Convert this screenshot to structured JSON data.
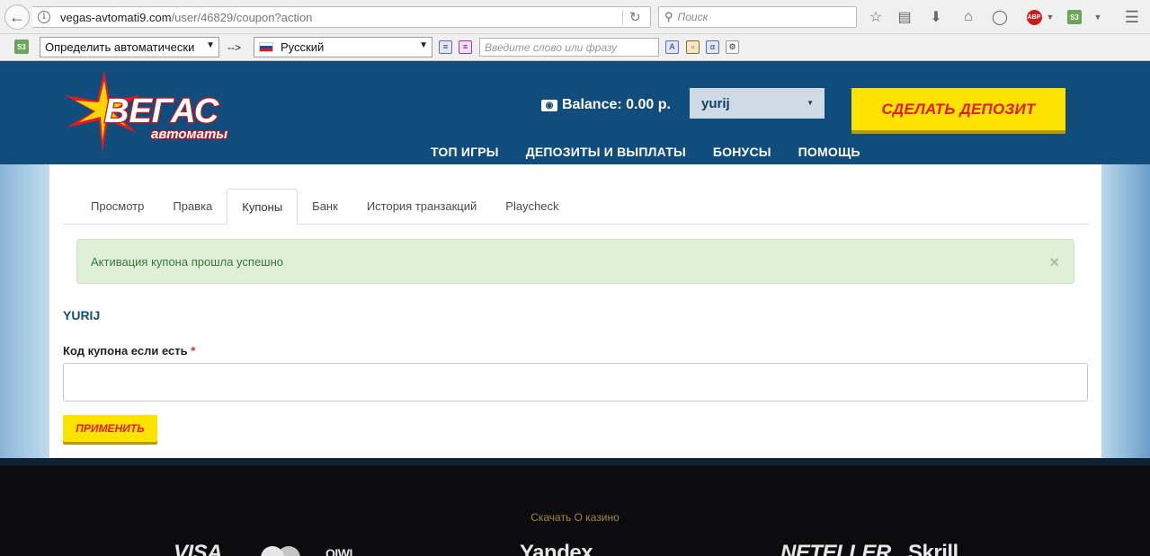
{
  "browser": {
    "url_host": "vegas-avtomati9.com",
    "url_path": "/user/46829/coupon?action",
    "search_placeholder": "Поиск",
    "abp_label": "ABP",
    "s3_label": "S3"
  },
  "translate_bar": {
    "source_lang": "Определить автоматически",
    "arrow": "-->",
    "target_lang": "Русский",
    "phrase_placeholder": "Введите слово или фразу"
  },
  "site": {
    "logo_main": "ВЕГАС",
    "logo_sub": "автоматы",
    "balance": "Balance: 0.00 р.",
    "username": "yurij",
    "deposit_button": "СДЕЛАТЬ ДЕПОЗИТ",
    "nav": [
      "ТОП ИГРЫ",
      "ДЕПОЗИТЫ И ВЫПЛАТЫ",
      "БОНУСЫ",
      "ПОМОЩЬ"
    ]
  },
  "tabs": [
    "Просмотр",
    "Правка",
    "Купоны",
    "Банк",
    "История транзакций",
    "Playcheck"
  ],
  "active_tab": "Купоны",
  "alert": {
    "message": "Активация купона прошла успешно",
    "close": "×"
  },
  "form": {
    "title": "YURIJ",
    "label": "Код купона если есть",
    "required_mark": "*",
    "value": "",
    "submit": "ПРИМЕНИТЬ"
  },
  "footer": {
    "link": "Скачать О казино",
    "payment_logos": [
      "VISA",
      "QIWI",
      "Yandex",
      "NETELLER",
      "Skrill"
    ]
  },
  "colors": {
    "header_bg": "#114d7c",
    "deposit_bg": "#ffe300",
    "deposit_text": "#e41b1b",
    "alert_bg": "#dff0d8",
    "alert_text": "#3c763d"
  }
}
